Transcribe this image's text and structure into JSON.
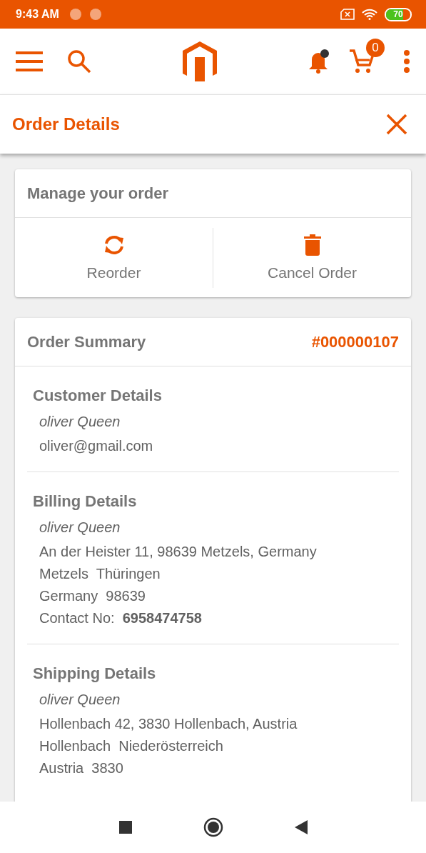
{
  "status_bar": {
    "time": "9:43 AM",
    "battery": "70"
  },
  "toolbar": {
    "cart_count": "0",
    "notification_dot": true
  },
  "title_bar": {
    "title": "Order Details"
  },
  "manage_card": {
    "title": "Manage your order",
    "actions": [
      {
        "kind": "reorder",
        "label": "Reorder"
      },
      {
        "kind": "cancel",
        "label": "Cancel Order"
      }
    ]
  },
  "summary_card": {
    "title": "Order Summary",
    "order_number": "#000000107",
    "sections": [
      {
        "heading": "Customer Details",
        "name": "oliver Queen",
        "lines": [
          "oliver@gmail.com"
        ]
      },
      {
        "heading": "Billing Details",
        "name": "oliver Queen",
        "lines": [
          "An der Heister 11, 98639 Metzels, Germany",
          "Metzels  Thüringen",
          "Germany  98639",
          "Contact No:  **6958474758**"
        ]
      },
      {
        "heading": "Shipping Details",
        "name": "oliver Queen",
        "lines": [
          "Hollenbach 42, 3830 Hollenbach, Austria",
          "Hollenbach  Niederösterreich",
          "Austria  3830"
        ]
      }
    ]
  }
}
